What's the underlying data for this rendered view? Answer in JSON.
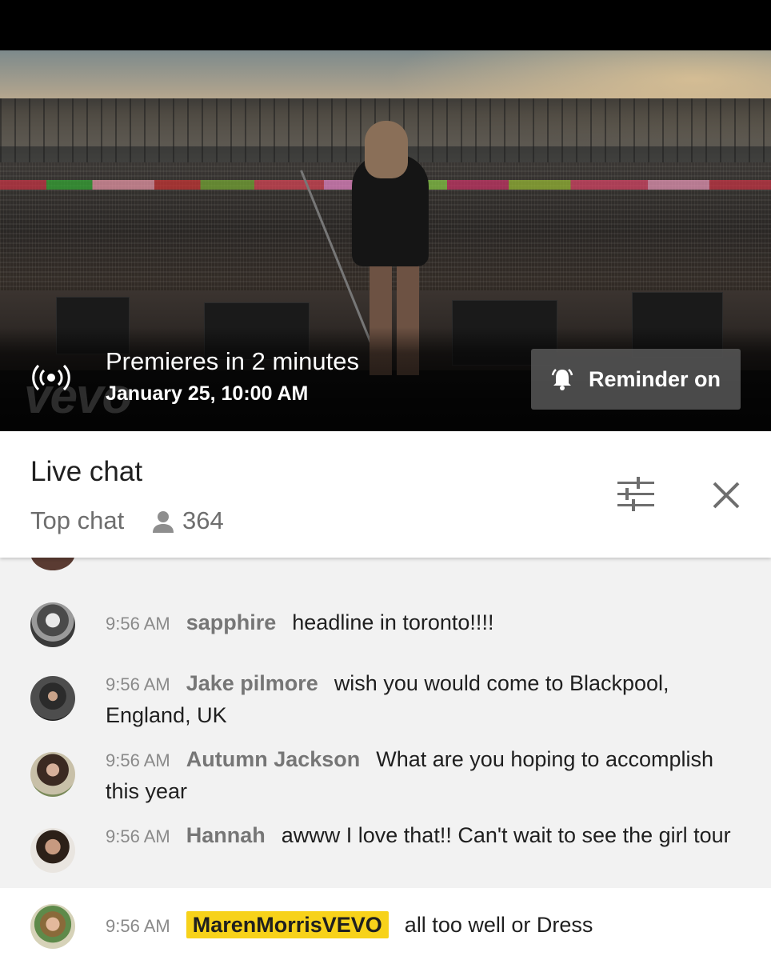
{
  "video": {
    "premiere_title": "Premieres in 2 minutes",
    "premiere_date": "January 25, 10:00 AM",
    "reminder_label": "Reminder on",
    "watermark": "vevo",
    "live_icon": "live-broadcast-icon",
    "reminder_icon": "bell-ringing-icon"
  },
  "chat": {
    "title": "Live chat",
    "mode": "Top chat",
    "viewer_count": "364",
    "viewer_icon": "person-icon",
    "filter_icon": "sliders-icon",
    "close_icon": "close-icon",
    "messages": [
      {
        "time": "9:56 AM",
        "author": "sapphire",
        "text": "headline in toronto!!!!"
      },
      {
        "time": "9:56 AM",
        "author": "Jake pilmore",
        "text": "wish you would come to Blackpool, England, UK"
      },
      {
        "time": "9:56 AM",
        "author": "Autumn Jackson",
        "text": "What are you hoping to accomplish this year"
      },
      {
        "time": "9:56 AM",
        "author": "Hannah",
        "text": "awww I love that!! Can't wait to see the girl tour"
      }
    ],
    "pinned": {
      "time": "9:56 AM",
      "author": "MarenMorrisVEVO",
      "text": "all too well or Dress"
    }
  },
  "colors": {
    "owner_badge": "#f7d21a",
    "chat_background": "#f2f2f2"
  }
}
